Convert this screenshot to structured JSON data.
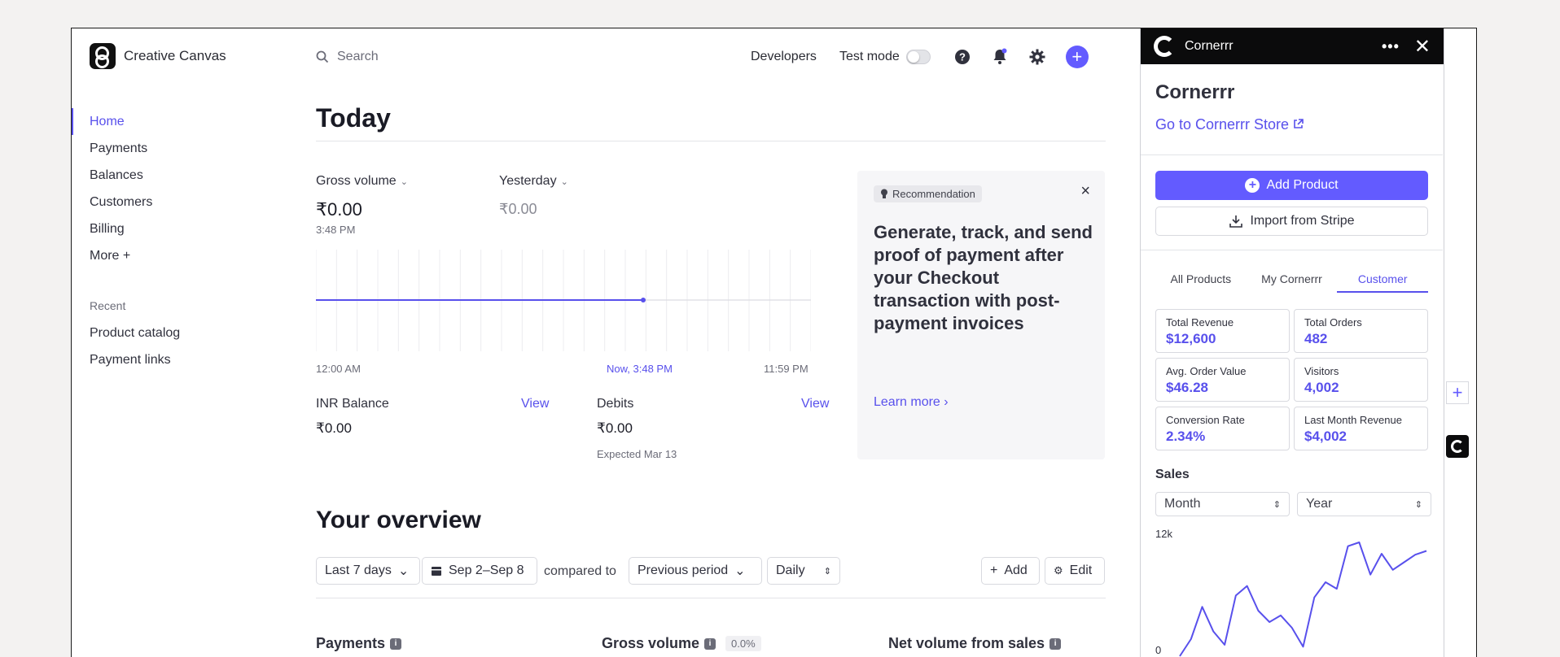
{
  "brand": {
    "name": "Creative Canvas"
  },
  "nav": {
    "items": [
      {
        "label": "Home"
      },
      {
        "label": "Payments"
      },
      {
        "label": "Balances"
      },
      {
        "label": "Customers"
      },
      {
        "label": "Billing"
      },
      {
        "label": "More +"
      }
    ],
    "recent_title": "Recent",
    "recent": [
      {
        "label": "Product catalog"
      },
      {
        "label": "Payment links"
      }
    ]
  },
  "topbar": {
    "search_placeholder": "Search",
    "developers": "Developers",
    "test_mode": "Test mode"
  },
  "today": {
    "title": "Today",
    "gross_volume_label": "Gross volume",
    "gross_volume_value": "₹0.00",
    "gross_volume_time": "3:48 PM",
    "yesterday_label": "Yesterday",
    "yesterday_value": "₹0.00",
    "axis_start": "12:00 AM",
    "axis_now": "Now, 3:48 PM",
    "axis_end": "11:59 PM",
    "inr_balance_label": "INR Balance",
    "inr_balance_value": "₹0.00",
    "view_label": "View",
    "debits_label": "Debits",
    "debits_value": "₹0.00",
    "debits_expected": "Expected Mar 13"
  },
  "recommendation": {
    "tag": "Recommendation",
    "title": "Generate, track, and send proof of payment after your Checkout transaction with post-payment invoices",
    "link": "Learn more"
  },
  "overview": {
    "title": "Your overview",
    "range": "Last 7 days",
    "dates": "Sep 2–Sep 8",
    "compared_to": "compared to",
    "comparison": "Previous period",
    "interval": "Daily",
    "add": "Add",
    "edit": "Edit",
    "sections": [
      {
        "label": "Payments"
      },
      {
        "label": "Gross volume",
        "badge": "0.0%"
      },
      {
        "label": "Net volume from sales"
      }
    ]
  },
  "panel": {
    "app_name": "Cornerrr",
    "title": "Cornerrr",
    "store_link": "Go to Cornerrr Store",
    "add_product": "Add Product",
    "import": "Import from Stripe",
    "tabs": [
      {
        "label": "All Products"
      },
      {
        "label": "My Cornerrr"
      },
      {
        "label": "Customer"
      }
    ],
    "stats": [
      {
        "label": "Total Revenue",
        "value": "$12,600"
      },
      {
        "label": "Total Orders",
        "value": "482"
      },
      {
        "label": "Avg. Order Value",
        "value": "$46.28"
      },
      {
        "label": "Visitors",
        "value": "4,002"
      },
      {
        "label": "Conversion Rate",
        "value": "2.34%"
      },
      {
        "label": "Last Month Revenue",
        "value": "$4,002"
      }
    ],
    "sales_title": "Sales",
    "month_select": "Month",
    "year_select": "Year"
  },
  "chart_data": {
    "type": "line",
    "ylim": [
      0,
      12000
    ],
    "tick_labels": [
      "12k",
      "0"
    ],
    "values": [
      0,
      1800,
      5200,
      2600,
      1200,
      6400,
      7400,
      4800,
      3600,
      4300,
      3000,
      1000,
      6200,
      7800,
      7100,
      11600,
      12000,
      8600,
      10800,
      9100,
      9900,
      10700,
      11100
    ]
  },
  "colors": {
    "accent": "#635bff",
    "link": "#5850ec"
  }
}
